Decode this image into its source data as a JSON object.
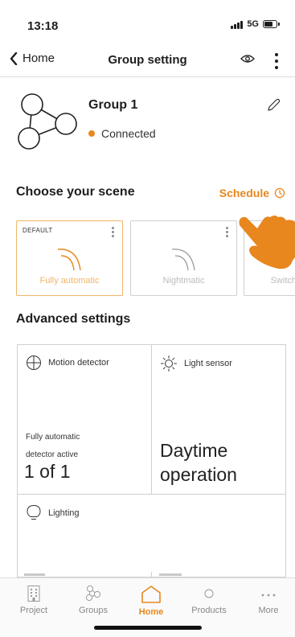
{
  "status_bar": {
    "time": "13:18",
    "network": "5G"
  },
  "navbar": {
    "back_label": "Home",
    "title": "Group setting"
  },
  "group": {
    "name": "Group 1",
    "status": "Connected"
  },
  "scenes": {
    "heading": "Choose your scene",
    "schedule_label": "Schedule",
    "items": [
      {
        "tag": "DEFAULT",
        "label": "Fully automatic",
        "active": true
      },
      {
        "tag": "",
        "label": "Nightmatic",
        "active": false
      },
      {
        "tag": "",
        "label": "Switch",
        "active": false
      }
    ]
  },
  "advanced": {
    "heading": "Advanced settings",
    "motion": {
      "title": "Motion detector",
      "line1": "Fully automatic",
      "line2": "detector active",
      "value": "1 of 1"
    },
    "light_sensor": {
      "title": "Light sensor",
      "value_line1": "Daytime",
      "value_line2": "operation"
    },
    "lighting": {
      "title": "Lighting"
    }
  },
  "tabbar": {
    "items": [
      {
        "label": "Project",
        "icon": "building-icon"
      },
      {
        "label": "Groups",
        "icon": "groups-icon"
      },
      {
        "label": "Home",
        "icon": "home-icon",
        "active": true
      },
      {
        "label": "Products",
        "icon": "circle-icon"
      },
      {
        "label": "More",
        "icon": "more-dots-icon"
      }
    ]
  },
  "colors": {
    "accent": "#e8871e",
    "accent_light": "#f0b46a",
    "border": "#cfcfcf"
  }
}
